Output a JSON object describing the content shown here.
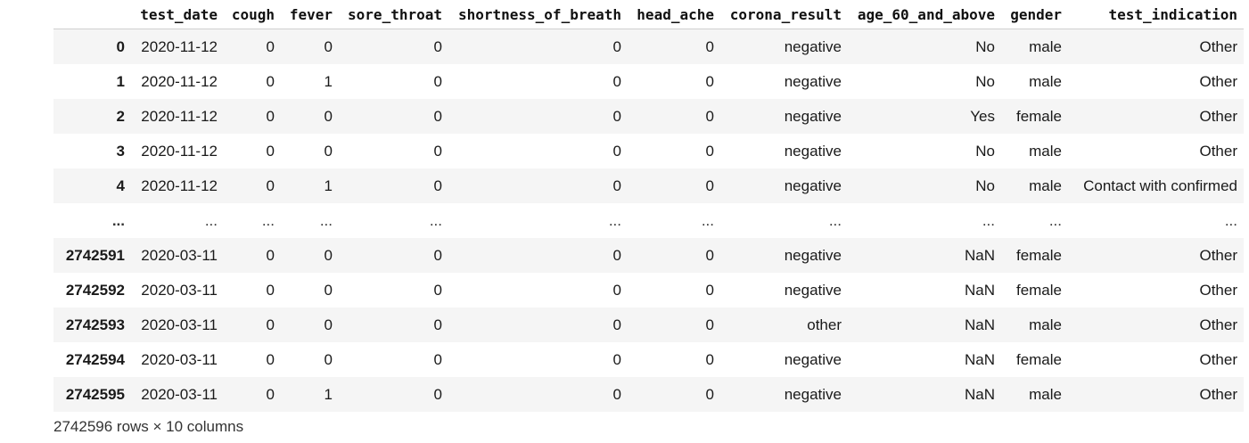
{
  "table": {
    "index_header": "",
    "columns": [
      "test_date",
      "cough",
      "fever",
      "sore_throat",
      "shortness_of_breath",
      "head_ache",
      "corona_result",
      "age_60_and_above",
      "gender",
      "test_indication"
    ],
    "rows": [
      {
        "index": "0",
        "cells": [
          "2020-11-12",
          "0",
          "0",
          "0",
          "0",
          "0",
          "negative",
          "No",
          "male",
          "Other"
        ]
      },
      {
        "index": "1",
        "cells": [
          "2020-11-12",
          "0",
          "1",
          "0",
          "0",
          "0",
          "negative",
          "No",
          "male",
          "Other"
        ]
      },
      {
        "index": "2",
        "cells": [
          "2020-11-12",
          "0",
          "0",
          "0",
          "0",
          "0",
          "negative",
          "Yes",
          "female",
          "Other"
        ]
      },
      {
        "index": "3",
        "cells": [
          "2020-11-12",
          "0",
          "0",
          "0",
          "0",
          "0",
          "negative",
          "No",
          "male",
          "Other"
        ]
      },
      {
        "index": "4",
        "cells": [
          "2020-11-12",
          "0",
          "1",
          "0",
          "0",
          "0",
          "negative",
          "No",
          "male",
          "Contact with confirmed"
        ]
      },
      {
        "index": "...",
        "cells": [
          "...",
          "...",
          "...",
          "...",
          "...",
          "...",
          "...",
          "...",
          "...",
          "..."
        ]
      },
      {
        "index": "2742591",
        "cells": [
          "2020-03-11",
          "0",
          "0",
          "0",
          "0",
          "0",
          "negative",
          "NaN",
          "female",
          "Other"
        ]
      },
      {
        "index": "2742592",
        "cells": [
          "2020-03-11",
          "0",
          "0",
          "0",
          "0",
          "0",
          "negative",
          "NaN",
          "female",
          "Other"
        ]
      },
      {
        "index": "2742593",
        "cells": [
          "2020-03-11",
          "0",
          "0",
          "0",
          "0",
          "0",
          "other",
          "NaN",
          "male",
          "Other"
        ]
      },
      {
        "index": "2742594",
        "cells": [
          "2020-03-11",
          "0",
          "0",
          "0",
          "0",
          "0",
          "negative",
          "NaN",
          "female",
          "Other"
        ]
      },
      {
        "index": "2742595",
        "cells": [
          "2020-03-11",
          "0",
          "1",
          "0",
          "0",
          "0",
          "negative",
          "NaN",
          "male",
          "Other"
        ]
      }
    ]
  },
  "footer": "2742596 rows × 10 columns"
}
